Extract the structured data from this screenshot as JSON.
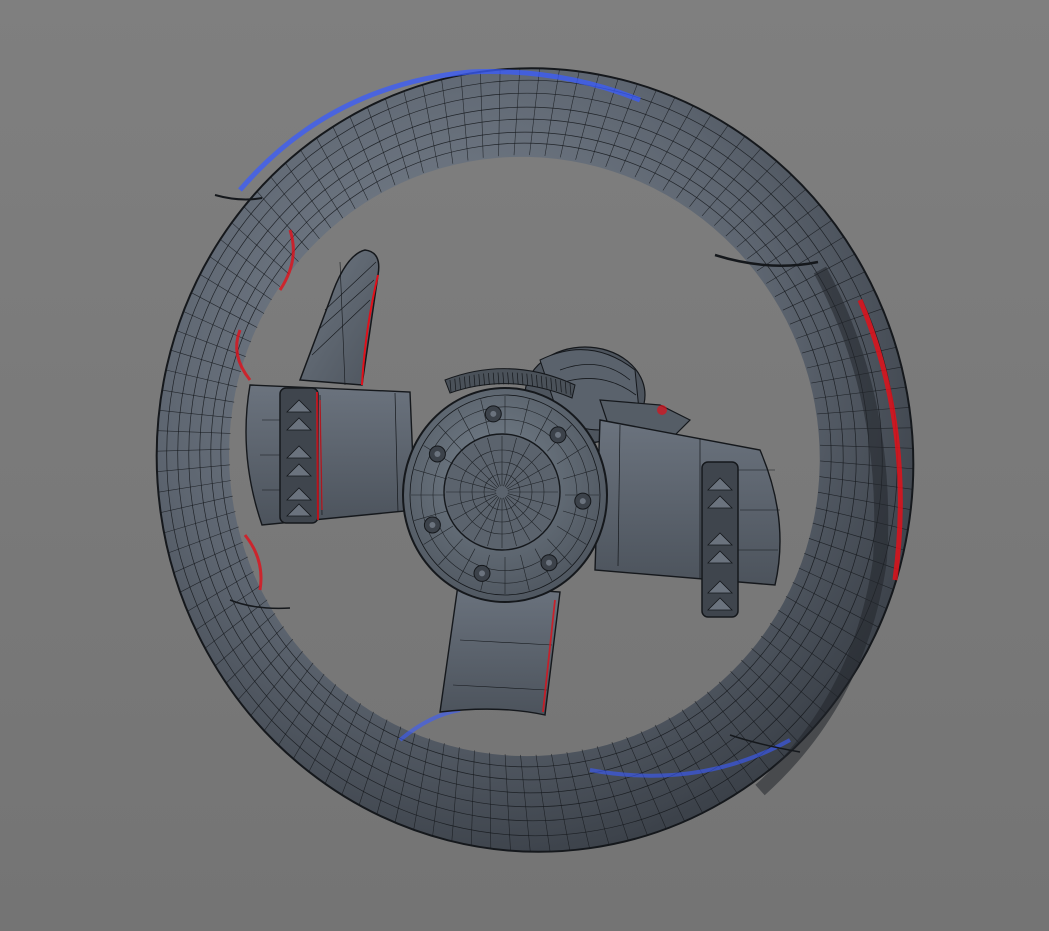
{
  "viewport": {
    "background_top": "#7f7f7f",
    "background_bottom": "#747474"
  },
  "model": {
    "subject": "steering-wheel",
    "display_mode": "shaded-wireframe",
    "colors": {
      "surface": "#59616b",
      "surface_light": "#77808b",
      "surface_dark": "#2e333a",
      "wire": "#15181c",
      "rim_light_blue": "#3a5cff",
      "rim_light_red": "#e0101a"
    }
  }
}
